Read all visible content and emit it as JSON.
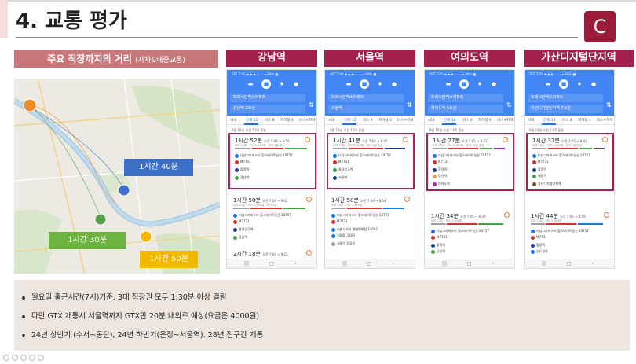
{
  "page": {
    "title": "4. 교통 평가",
    "logo_letter": "C",
    "section": {
      "label": "주요 직장까지의 거리",
      "sub_label": "(자차&대중교통)"
    }
  },
  "map": {
    "tags": [
      "1시간 40분",
      "1시간 30분",
      "1시간 50분"
    ],
    "colors": {
      "orange": "#ee8a2a",
      "blue": "#3c6fc8",
      "green": "#5aa24a",
      "yellow": "#f2b800",
      "tag_blue": "#3c6fc8",
      "tag_green": "#6db33f",
      "tag_yellow": "#f2b800"
    }
  },
  "stations": [
    "강남역",
    "서울역",
    "여의도역",
    "가산디지털단지역"
  ],
  "phones": [
    {
      "origin": "트레시안팩스아파트",
      "dest": "강남역 2호선",
      "tabs": [
        "시내",
        "전체 15",
        "버스 8",
        "지하철 3",
        "버스+지하"
      ],
      "departure": "9월 18일 오전 7:04 출발",
      "routes": [
        {
          "time": "1시간 52분",
          "range": "오전 7:04 → 8:56",
          "sub": "도보 14분 · 카드 2,800원 · 대기 9분 환승",
          "lines": [
            "더샵그라비스타 힐스테이트일산 20757",
            "M7731",
            "합정역",
            "강남역"
          ]
        },
        {
          "time": "1시간 58분",
          "range": "오전 7:04 → 9:02",
          "sub": "도보 10분 · 카드 2,800원 · 대기 9분",
          "lines": [
            "더샵그라비스타 힐스테이트일산 20757",
            "M7731",
            "홍대입구역",
            "강남역"
          ]
        },
        {
          "time": "2시간 18분",
          "range": "오전 7:04 → 9:22",
          "sub": "",
          "lines": []
        }
      ]
    },
    {
      "origin": "트레시안팩스아파트",
      "dest": "서울역",
      "tabs": [
        "시내",
        "전체 15",
        "버스 8",
        "지하철 3",
        "버스+지하"
      ],
      "departure": "9월 18일 오전 7:04 출발",
      "routes": [
        {
          "time": "1시간 41분",
          "range": "오전 7:04 → 8:45",
          "sub": "도보 11분 · 카드 2,800원 · 대기 9분 환승",
          "lines": [
            "더샵그라비스타 힐스테이트일산 20757",
            "M7731",
            "홍대입구역",
            "서울역"
          ]
        },
        {
          "time": "1시간 50분",
          "range": "오전 7:04 → 8:54",
          "sub": "도보 10분 · 카드 2,800원",
          "lines": [
            "더샵그라비스타 힐스테이트일산 20757",
            "M7731",
            "신촌오거리.현대백화점 14002",
            "1000, 1400",
            "서울역 정류장"
          ]
        }
      ]
    },
    {
      "origin": "트레시안팩스아파트",
      "dest": "여의도역 5호선",
      "tabs": [
        "시내",
        "전체 18",
        "버스 4",
        "지하철 4",
        "버스+지하"
      ],
      "departure": "9월 18일 오전 7:05 출발",
      "routes": [
        {
          "time": "1시간 27분",
          "range": "오전 7:05 → 8:32",
          "sub": "도보 12분 · 카드 2,800원 · 대기 11분 환승",
          "lines": [
            "더샵그라비스타 힐스테이트일산 20757",
            "M7731",
            "합정역",
            "당산역",
            "여의도역"
          ]
        },
        {
          "time": "1시간 34분",
          "range": "오전 7:05 → 8:39",
          "sub": "도보 12분 · 카드 2,800원",
          "lines": [
            "더샵그라비스타 힐스테이트일산 20757",
            "M7731",
            "합정역",
            "당산역"
          ]
        }
      ]
    },
    {
      "origin": "트레시안팩스아파트",
      "dest": "가산디지털단지역 7호선",
      "tabs": [
        "시내",
        "전체 18",
        "버스 4",
        "지하철 4",
        "버스+지하"
      ],
      "departure": "9월 18일 오전 7:05 출발",
      "routes": [
        {
          "time": "1시간 37분",
          "range": "오전 7:05 → 8:42",
          "sub": "도보 12분 · 카드 2,800원 · 대기 9분 환승",
          "lines": [
            "더샵그라비스타 힐스테이트일산 20757",
            "M7731",
            "합정역",
            "대림역",
            "가산디지털단지역"
          ]
        },
        {
          "time": "1시간 44분",
          "range": "오전 7:05 → 8:49",
          "sub": "도보 12분 · 카드 2,800원",
          "lines": [
            "더샵그라비스타 힐스테이트일산 20757",
            "M7731",
            "합정역",
            "신도림역"
          ]
        }
      ]
    }
  ],
  "bullets": [
    "월요일 출근시간(7시)기준. 3대 직장권 모두 1:30분 이상 걸림",
    "다만 GTX 개통시 서울역까지 GTX만 20분 내외로 예상(요금은 4000원)",
    "24년 상반기 (수서~동탄), 24년 하반기(운정~서울역). 28년 전구간 개통"
  ]
}
